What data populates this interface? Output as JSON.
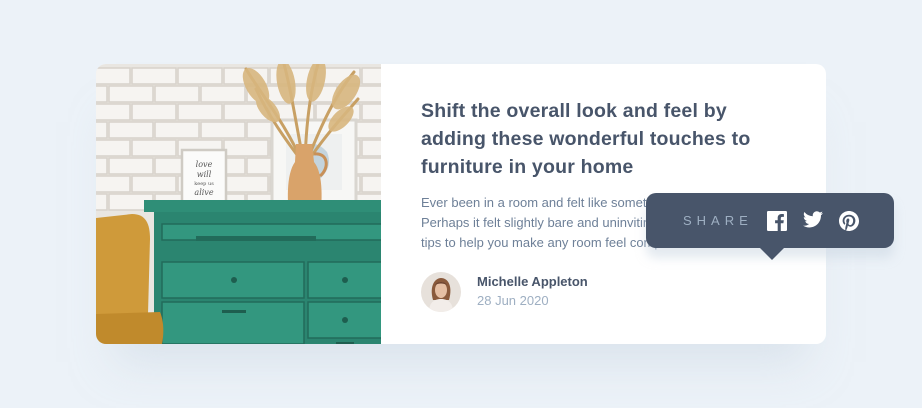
{
  "article": {
    "title": "Shift the overall look and feel by adding these wonderful touches to furniture in your home",
    "description": "Ever been in a room and felt like something was missing? Perhaps it felt slightly bare and uninviting. I've got some simple tips to help you make any room feel complete."
  },
  "author": {
    "name": "Michelle Appleton",
    "date": "28 Jun 2020"
  },
  "share": {
    "label": "SHARE",
    "networks": [
      "facebook-icon",
      "twitter-icon",
      "pinterest-icon"
    ]
  },
  "image": {
    "frame_text": [
      "love",
      "will",
      "keep us",
      "alive"
    ]
  },
  "colors": {
    "background": "#ecf2f8",
    "dark_blue": "#48556a",
    "grayish_blue": "#6e8098",
    "light_grayish_blue": "#9eafc2",
    "drawer_green": "#2e8a74"
  }
}
